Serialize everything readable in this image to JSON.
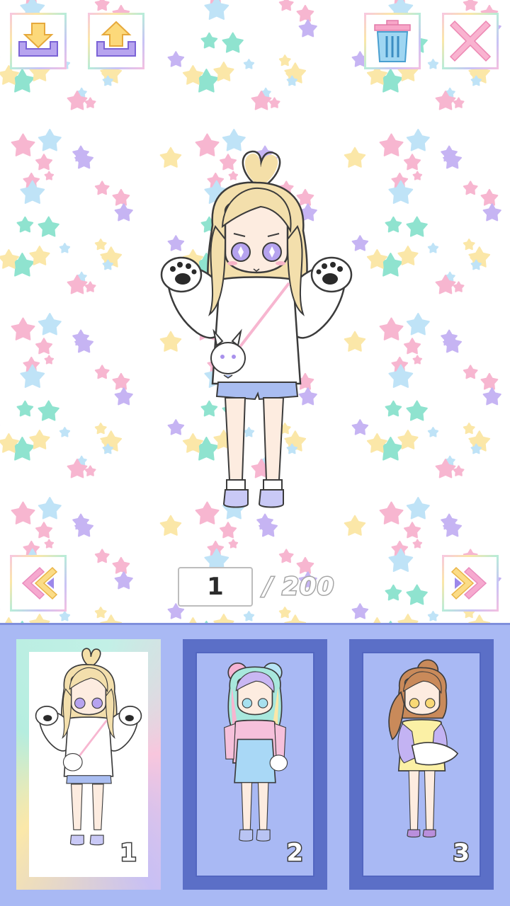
{
  "toolbar": {
    "import_icon": "download-tray-icon",
    "export_icon": "upload-tray-icon",
    "delete_icon": "trash-can-icon",
    "close_icon": "close-x-icon"
  },
  "pager": {
    "current_page": "1",
    "total_label": "/ 200",
    "prev_icon": "double-chevron-left-icon",
    "next_icon": "double-chevron-right-icon"
  },
  "slots": [
    {
      "number": "1",
      "selected": true
    },
    {
      "number": "2",
      "selected": false
    },
    {
      "number": "3",
      "selected": false
    }
  ],
  "colors": {
    "tray_bg": "#a9b9f4",
    "frame_blue": "#5b6fc7",
    "star_colors": [
      "#8fe3cf",
      "#f7b6d0",
      "#c6b4f3",
      "#fbe7a8",
      "#bfe3f7"
    ]
  }
}
